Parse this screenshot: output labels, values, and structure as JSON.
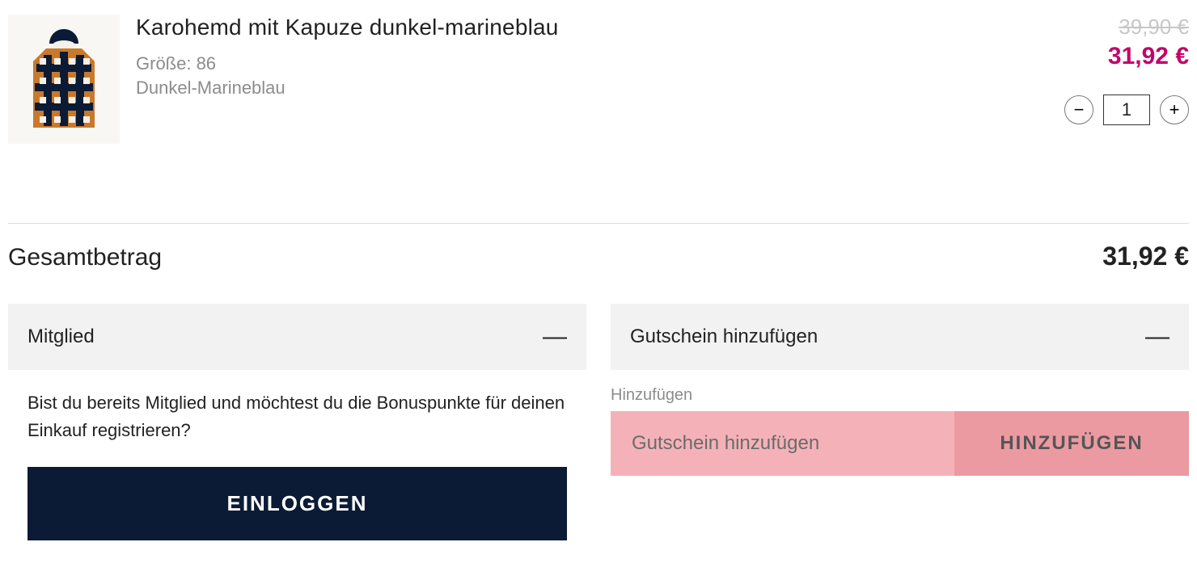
{
  "item": {
    "title": "Karohemd mit Kapuze dunkel-marineblau",
    "size_label": "Größe: 86",
    "color": "Dunkel-Marineblau",
    "old_price": "39,90 €",
    "new_price": "31,92 €",
    "qty": "1"
  },
  "total": {
    "label": "Gesamtbetrag",
    "value": "31,92 €"
  },
  "member": {
    "title": "Mitglied",
    "toggle": "—",
    "text": "Bist du bereits Mitglied und möchtest du die Bonuspunkte für deinen Einkauf registrieren?",
    "login": "EINLOGGEN"
  },
  "voucher": {
    "title": "Gutschein hinzufügen",
    "toggle": "—",
    "hint": "Hinzufügen",
    "placeholder": "Gutschein hinzufügen",
    "button": "HINZUFÜGEN"
  }
}
